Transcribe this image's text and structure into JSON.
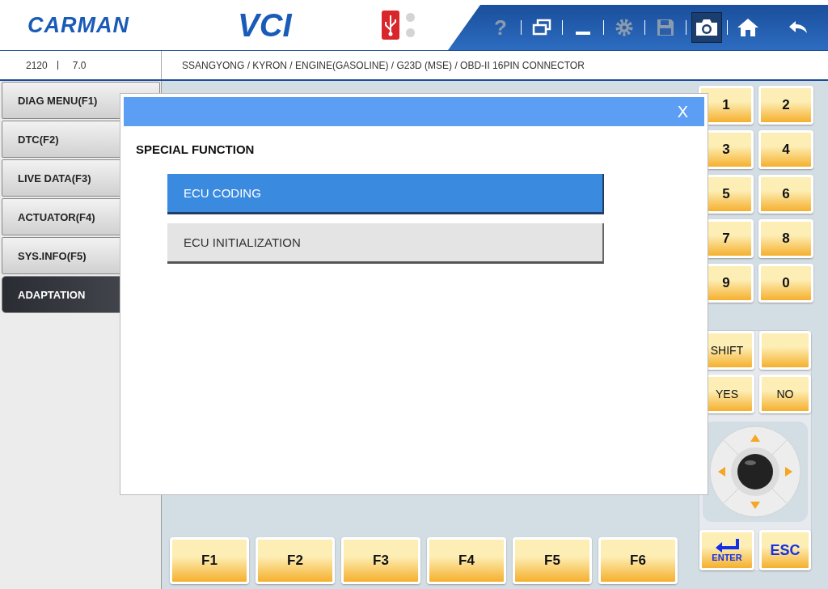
{
  "header": {
    "brand": "CARMAN",
    "product": "VCI",
    "toolbar": [
      {
        "kind": "help",
        "label": "?",
        "selected": false
      },
      {
        "kind": "window",
        "selected": false
      },
      {
        "kind": "minimize",
        "selected": false
      },
      {
        "kind": "settings",
        "selected": false
      },
      {
        "kind": "save",
        "selected": false
      },
      {
        "kind": "camera",
        "selected": true
      },
      {
        "kind": "home",
        "selected": false
      },
      {
        "kind": "back",
        "selected": false
      }
    ]
  },
  "info_bar": {
    "code": "2120",
    "version": "7.0",
    "path": "SSANGYONG / KYRON / ENGINE(GASOLINE) / G23D (MSE) / OBD-II 16PIN CONNECTOR"
  },
  "sidebar": {
    "items": [
      {
        "label": "DIAG MENU(F1)",
        "selected": false
      },
      {
        "label": "DTC(F2)",
        "selected": false
      },
      {
        "label": "LIVE DATA(F3)",
        "selected": false
      },
      {
        "label": "ACTUATOR(F4)",
        "selected": false
      },
      {
        "label": "SYS.INFO(F5)",
        "selected": false
      },
      {
        "label": "ADAPTATION",
        "selected": true
      }
    ]
  },
  "dialog": {
    "close": "X",
    "title": "SPECIAL FUNCTION",
    "options": [
      {
        "label": "ECU CODING",
        "selected": true
      },
      {
        "label": "ECU INITIALIZATION",
        "selected": false
      }
    ]
  },
  "function_keys": [
    "F1",
    "F2",
    "F3",
    "F4",
    "F5",
    "F6"
  ],
  "keypad": {
    "digits": [
      "1",
      "2",
      "3",
      "4",
      "5",
      "6",
      "7",
      "8",
      "9",
      "0"
    ],
    "keys": [
      {
        "kind": "key",
        "label": "SHIFT"
      },
      {
        "kind": "blank"
      },
      {
        "kind": "key",
        "label": "YES"
      },
      {
        "kind": "key",
        "label": "NO"
      }
    ],
    "enter": "ENTER",
    "esc": "ESC"
  }
}
